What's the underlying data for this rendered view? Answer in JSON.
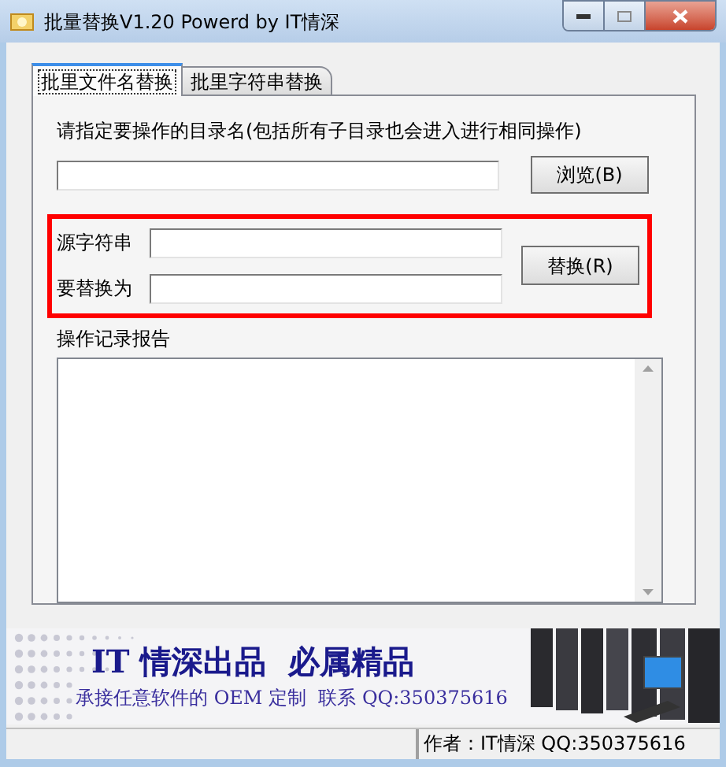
{
  "window": {
    "title": "批量替换V1.20  Powerd by IT情深"
  },
  "tabs": [
    {
      "label": "批里文件名替换",
      "selected": true
    },
    {
      "label": "批里字符串替换",
      "selected": false
    }
  ],
  "directory": {
    "label": "请指定要操作的目录名(包括所有子目录也会进入进行相同操作)",
    "browse_button": "浏览(B)"
  },
  "replace_group": {
    "source_label": "源字符串",
    "target_label": "要替换为",
    "replace_button": "替换(R)"
  },
  "log": {
    "label": "操作记录报告"
  },
  "banner": {
    "headline": "IT 情深出品  必属精品",
    "subline": "承接任意软件的 OEM 定制  联系 QQ:350375616"
  },
  "status_bar": {
    "author": "作者：IT情深 QQ:350375616"
  }
}
